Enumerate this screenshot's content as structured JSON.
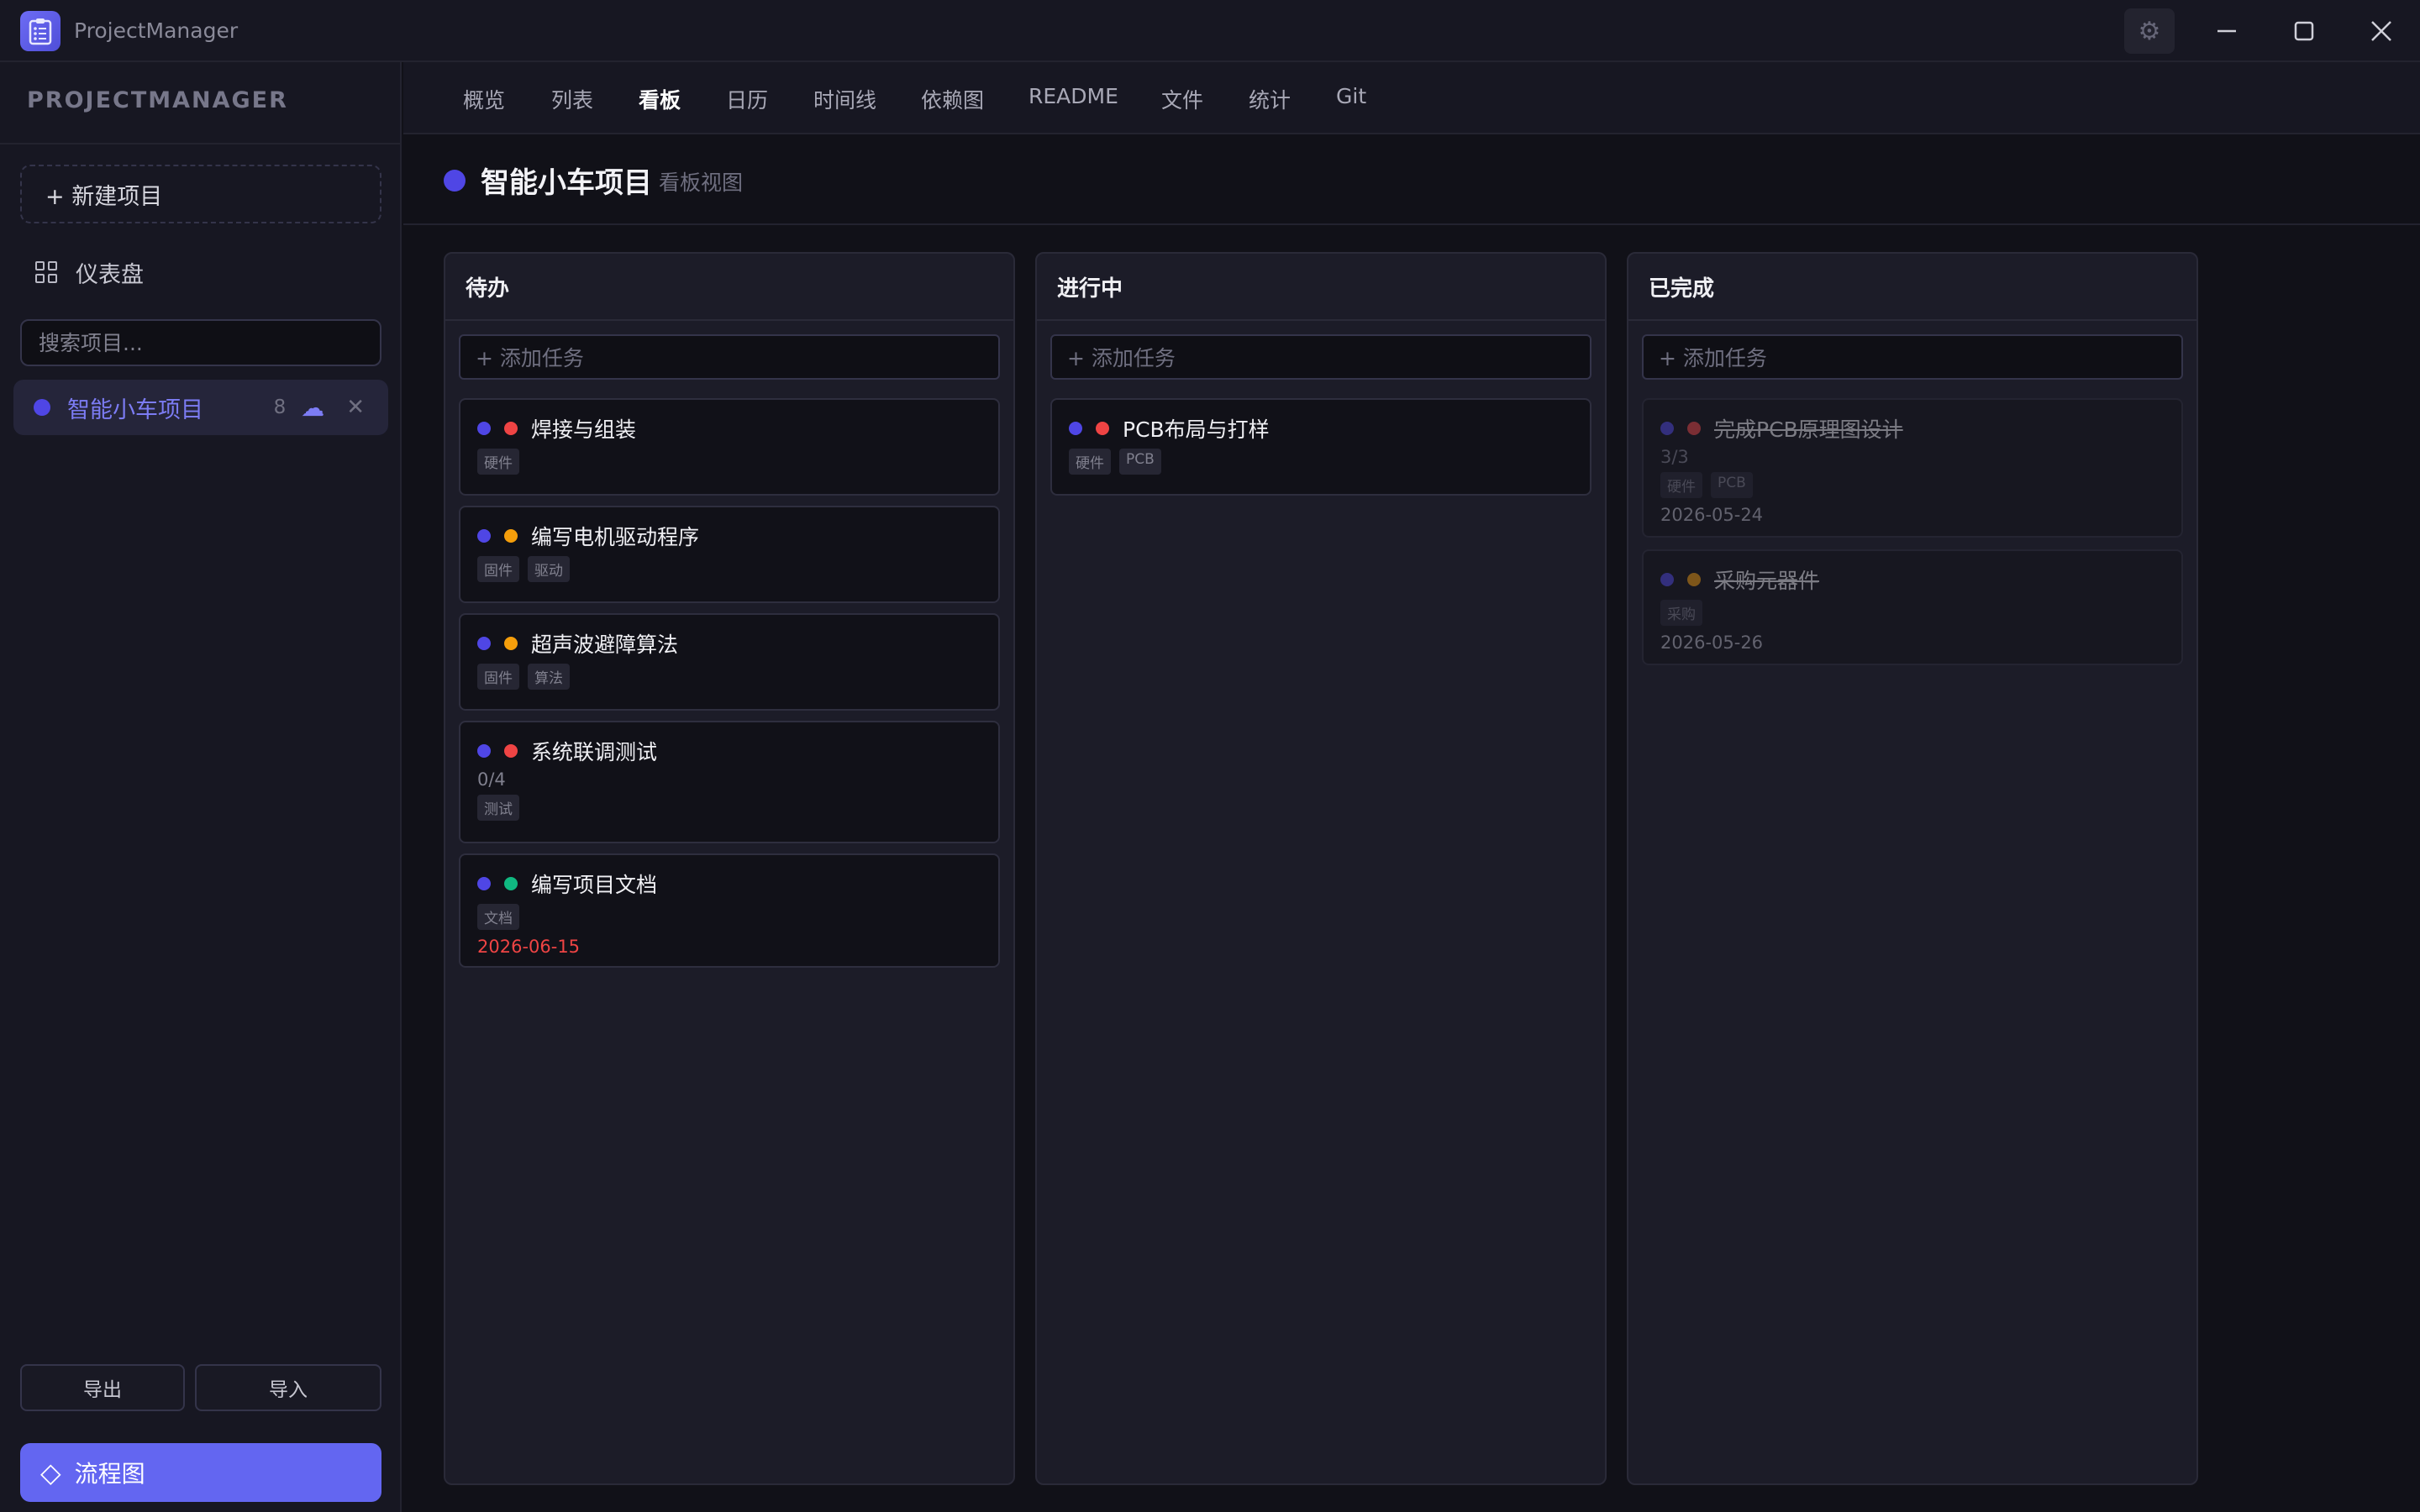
{
  "app": {
    "title": "ProjectManager"
  },
  "sidebar": {
    "brand": "PROJECTMANAGER",
    "new_project": "+ 新建项目",
    "dashboard": "仪表盘",
    "search_placeholder": "搜索项目...",
    "projects": [
      {
        "name": "智能小车项目",
        "count": "8",
        "color": "#4f46e5"
      }
    ],
    "export": "导出",
    "import": "导入",
    "flowchart": "流程图"
  },
  "tabs": [
    "概览",
    "列表",
    "看板",
    "日历",
    "时间线",
    "依赖图",
    "README",
    "文件",
    "统计",
    "Git"
  ],
  "active_tab": "看板",
  "page": {
    "title": "智能小车项目",
    "subtitle": "看板视图"
  },
  "board": {
    "add_task": "+ 添加任务",
    "columns": [
      {
        "title": "待办",
        "cards": [
          {
            "title": "焊接与组装",
            "priority_color": "#ef4444",
            "tags": [
              "硬件"
            ]
          },
          {
            "title": "编写电机驱动程序",
            "priority_color": "#f59e0b",
            "tags": [
              "固件",
              "驱动"
            ]
          },
          {
            "title": "超声波避障算法",
            "priority_color": "#f59e0b",
            "tags": [
              "固件",
              "算法"
            ]
          },
          {
            "title": "系统联调测试",
            "priority_color": "#ef4444",
            "progress": "0/4",
            "tags": [
              "测试"
            ]
          },
          {
            "title": "编写项目文档",
            "priority_color": "#10b981",
            "tags": [
              "文档"
            ],
            "date": "2026-06-15",
            "date_color": "#ef4444"
          }
        ]
      },
      {
        "title": "进行中",
        "cards": [
          {
            "title": "PCB布局与打样",
            "priority_color": "#ef4444",
            "tags": [
              "硬件",
              "PCB"
            ]
          }
        ]
      },
      {
        "title": "已完成",
        "cards": [
          {
            "title": "完成PCB原理图设计",
            "priority_color": "#ef4444",
            "progress": "3/3",
            "tags": [
              "硬件",
              "PCB"
            ],
            "date": "2026-05-24",
            "date_color": "#80808e"
          },
          {
            "title": "采购元器件",
            "priority_color": "#f59e0b",
            "tags": [
              "采购"
            ],
            "date": "2026-05-26",
            "date_color": "#80808e"
          }
        ]
      }
    ]
  }
}
